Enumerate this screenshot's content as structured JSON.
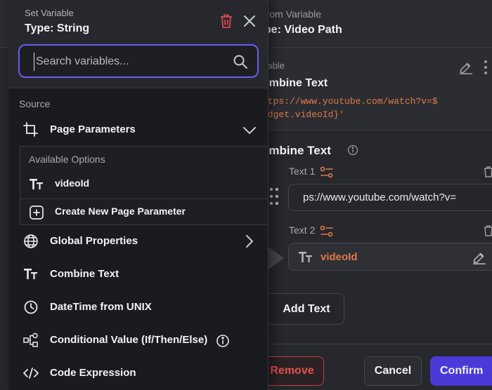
{
  "background_panel": {
    "subtitle": "t from Variable",
    "title": "ype: Video Path",
    "variable_card": {
      "label": "riable",
      "value": "ombine Text",
      "code_line1": "ttps://www.youtube.com/watch?v=$",
      "code_line2": "idget.videoId}'"
    },
    "combine": {
      "title": "ombine Text",
      "text1_label": "Text 1",
      "text1_value": "ps://www.youtube.com/watch?v=",
      "text2_label": "Text 2",
      "text2_value": "videoId",
      "add_text_label": "Add Text"
    },
    "footer": {
      "remove_label": "Remove",
      "cancel_label": "Cancel",
      "confirm_label": "Confirm"
    }
  },
  "popup": {
    "subtitle": "Set Variable",
    "title": "Type: String",
    "search": {
      "placeholder": "Search variables..."
    },
    "source_label": "Source",
    "items": [
      {
        "label": "Page Parameters",
        "icon": "crop-icon",
        "expanded": true
      },
      {
        "label": "Global Properties",
        "icon": "globe-icon",
        "expandable": true
      },
      {
        "label": "Combine Text",
        "icon": "text-type-icon"
      },
      {
        "label": "DateTime from UNIX",
        "icon": "clock-icon"
      },
      {
        "label": "Conditional Value (If/Then/Else)",
        "icon": "conditional-icon"
      },
      {
        "label": "Code Expression",
        "icon": "code-icon"
      }
    ],
    "available_options": {
      "title": "Available Options",
      "options": [
        {
          "label": "videoId",
          "icon": "text-type-icon"
        },
        {
          "label": "Create New Page Parameter",
          "icon": "plus-square-icon"
        }
      ]
    }
  },
  "colors": {
    "accent": "#6a5cf0",
    "confirm": "#4b39d8",
    "danger": "#e55050",
    "code": "#e07a46"
  }
}
